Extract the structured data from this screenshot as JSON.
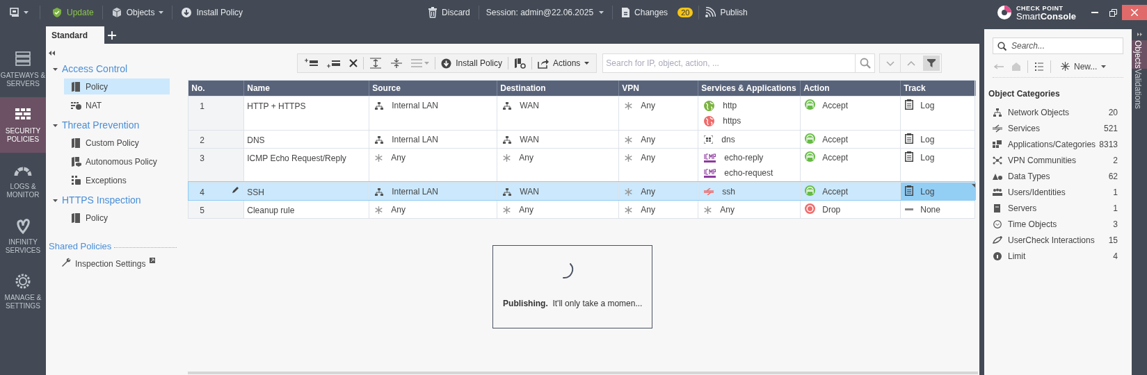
{
  "top_bar": {
    "left": [
      {
        "kind": "menu"
      },
      {
        "kind": "update",
        "label": "Update"
      },
      {
        "kind": "objects",
        "label": "Objects"
      },
      {
        "kind": "install",
        "label": "Install Policy"
      }
    ],
    "discard": "Discard",
    "session": "Session: admin@22.06.2025",
    "changes": "Changes",
    "changes_count": "20",
    "publish": "Publish",
    "logo_top": "CHECK POINT",
    "logo_bottom_a": "Smart",
    "logo_bottom_b": "Console"
  },
  "tabs": [
    {
      "label": "Standard",
      "selected": true
    }
  ],
  "nav": [
    {
      "label": "GATEWAYS & SERVERS",
      "selected": false
    },
    {
      "label": "SECURITY POLICIES",
      "selected": true
    },
    {
      "label": "LOGS & MONITOR",
      "selected": false
    },
    {
      "label": "INFINITY SERVICES",
      "selected": false
    },
    {
      "label": "MANAGE & SETTINGS",
      "selected": false
    }
  ],
  "tree": [
    {
      "label": "Access Control",
      "expanded": true,
      "children": [
        {
          "label": "Policy",
          "kind": "policy",
          "selected": true
        },
        {
          "label": "NAT",
          "kind": "nat",
          "selected": false
        }
      ]
    },
    {
      "label": "Threat Prevention",
      "expanded": true,
      "children": [
        {
          "label": "Custom Policy",
          "kind": "policy",
          "selected": false
        },
        {
          "label": "Autonomous Policy",
          "kind": "autonomous",
          "selected": false
        },
        {
          "label": "Exceptions",
          "kind": "exceptions",
          "selected": false
        }
      ]
    },
    {
      "label": "HTTPS Inspection",
      "expanded": true,
      "children": [
        {
          "label": "Policy",
          "kind": "policy",
          "selected": false
        }
      ]
    }
  ],
  "shared": {
    "title": "Shared Policies",
    "items": [
      {
        "label": "Inspection Settings"
      }
    ]
  },
  "policy_toolbar": {
    "install": "Install Policy",
    "actions": "Actions",
    "search_placeholder": "Search for IP, object, action, ..."
  },
  "table": {
    "columns": [
      "No.",
      "Name",
      "Source",
      "Destination",
      "VPN",
      "Services & Applications",
      "Action",
      "Track"
    ],
    "rows": [
      {
        "no": "1",
        "name": "HTTP + HTTPS",
        "selected": false,
        "source": [
          {
            "text": "Internal LAN",
            "kind": "network"
          }
        ],
        "destination": [
          {
            "text": "WAN",
            "kind": "network"
          }
        ],
        "vpn": [
          {
            "text": "Any",
            "kind": "any"
          }
        ],
        "services": [
          {
            "text": "http",
            "kind": "web",
            "color": "#7cb342"
          },
          {
            "text": "https",
            "kind": "web",
            "color": "#f06a6a"
          }
        ],
        "action": {
          "text": "Accept",
          "kind": "accept"
        },
        "track": {
          "text": "Log",
          "kind": "log"
        }
      },
      {
        "no": "2",
        "name": "DNS",
        "selected": false,
        "source": [
          {
            "text": "Internal LAN",
            "kind": "network"
          }
        ],
        "destination": [
          {
            "text": "WAN",
            "kind": "network"
          }
        ],
        "vpn": [
          {
            "text": "Any",
            "kind": "any"
          }
        ],
        "services": [
          {
            "text": "dns",
            "kind": "dns"
          }
        ],
        "action": {
          "text": "Accept",
          "kind": "accept"
        },
        "track": {
          "text": "Log",
          "kind": "log"
        }
      },
      {
        "no": "3",
        "name": "ICMP Echo Request/Reply",
        "selected": false,
        "source": [
          {
            "text": "Any",
            "kind": "any"
          }
        ],
        "destination": [
          {
            "text": "Any",
            "kind": "any"
          }
        ],
        "vpn": [
          {
            "text": "Any",
            "kind": "any"
          }
        ],
        "services": [
          {
            "text": "echo-reply",
            "kind": "icmp"
          },
          {
            "text": "echo-request",
            "kind": "icmp"
          }
        ],
        "action": {
          "text": "Accept",
          "kind": "accept"
        },
        "track": {
          "text": "Log",
          "kind": "log"
        }
      },
      {
        "no": "4",
        "name": "SSH",
        "selected": true,
        "source": [
          {
            "text": "Internal LAN",
            "kind": "network"
          }
        ],
        "destination": [
          {
            "text": "WAN",
            "kind": "network"
          }
        ],
        "vpn": [
          {
            "text": "Any",
            "kind": "any"
          }
        ],
        "services": [
          {
            "text": "ssh",
            "kind": "ssh"
          }
        ],
        "action": {
          "text": "Accept",
          "kind": "accept"
        },
        "track": {
          "text": "Log",
          "kind": "log"
        }
      },
      {
        "no": "5",
        "name": "Cleanup rule",
        "selected": false,
        "source": [
          {
            "text": "Any",
            "kind": "any"
          }
        ],
        "destination": [
          {
            "text": "Any",
            "kind": "any"
          }
        ],
        "vpn": [
          {
            "text": "Any",
            "kind": "any"
          }
        ],
        "services": [
          {
            "text": "Any",
            "kind": "any"
          }
        ],
        "action": {
          "text": "Drop",
          "kind": "drop"
        },
        "track": {
          "text": "None",
          "kind": "none"
        }
      }
    ]
  },
  "dialog": {
    "message": "**Publishing.**  It'll only take a momen..."
  },
  "objects_panel": {
    "search_placeholder": "Search...",
    "new_button": "New...",
    "heading": "Object Categories",
    "categories": [
      {
        "label": "Network Objects",
        "count": "20"
      },
      {
        "label": "Services",
        "count": "521"
      },
      {
        "label": "Applications/Categories",
        "count": "8313"
      },
      {
        "label": "VPN Communities",
        "count": "2"
      },
      {
        "label": "Data Types",
        "count": "62"
      },
      {
        "label": "Users/Identities",
        "count": "1"
      },
      {
        "label": "Servers",
        "count": "1"
      },
      {
        "label": "Time Objects",
        "count": "3"
      },
      {
        "label": "UserCheck Interactions",
        "count": "15"
      },
      {
        "label": "Limit",
        "count": "4"
      }
    ]
  },
  "side_tabs": [
    {
      "label": "Objects",
      "selected": true
    },
    {
      "label": "Validations",
      "selected": false
    }
  ]
}
